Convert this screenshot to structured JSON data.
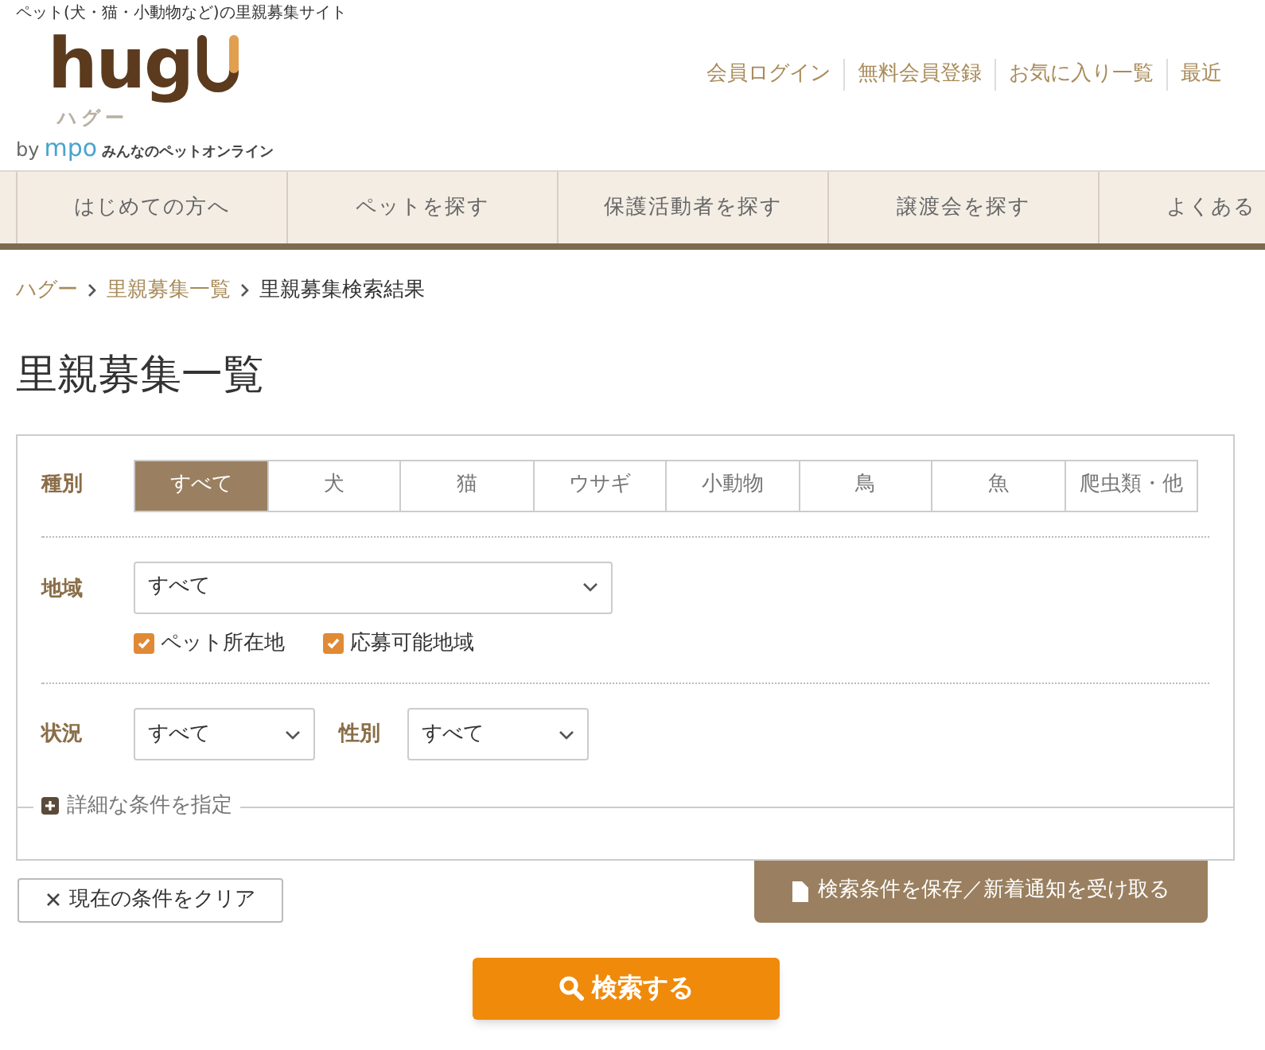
{
  "header": {
    "tagline": "ペット(犬・猫・小動物など)の里親募集サイト",
    "logo": {
      "wordmark": "hug",
      "kana": "ハグー",
      "by": "by",
      "brand": "mpo",
      "brand_tagline": "みんなのペットオンライン"
    },
    "links": [
      "会員ログイン",
      "無料会員登録",
      "お気に入り一覧",
      "最近"
    ]
  },
  "nav": [
    "はじめての方へ",
    "ペットを探す",
    "保護活動者を探す",
    "譲渡会を探す",
    "よくある"
  ],
  "breadcrumb": [
    "ハグー",
    "里親募集一覧",
    "里親募集検索結果"
  ],
  "page_title": "里親募集一覧",
  "search_form": {
    "type": {
      "label": "種別",
      "options": [
        {
          "label": "すべて",
          "selected": true
        },
        {
          "label": "犬",
          "selected": false
        },
        {
          "label": "猫",
          "selected": false
        },
        {
          "label": "ウサギ",
          "selected": false
        },
        {
          "label": "小動物",
          "selected": false
        },
        {
          "label": "鳥",
          "selected": false
        },
        {
          "label": "魚",
          "selected": false
        },
        {
          "label": "爬虫類・他",
          "selected": false
        }
      ]
    },
    "region": {
      "label": "地域",
      "value": "すべて",
      "checkboxes": [
        {
          "label": "ペット所在地",
          "checked": true
        },
        {
          "label": "応募可能地域",
          "checked": true
        }
      ]
    },
    "status": {
      "label": "状況",
      "value": "すべて"
    },
    "sex": {
      "label": "性別",
      "value": "すべて"
    },
    "details_toggle": "詳細な条件を指定"
  },
  "clear_button": "現在の条件をクリア",
  "save_button": "検索条件を保存／新着通知を受け取る",
  "search_button": "検索する"
}
